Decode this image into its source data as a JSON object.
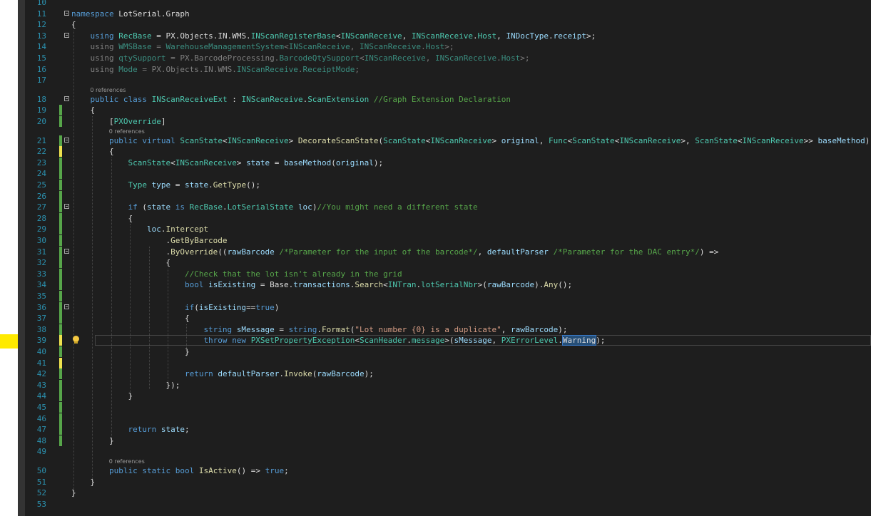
{
  "editor": {
    "lines": [
      {
        "n": "10",
        "tokens": []
      },
      {
        "n": "11",
        "tokens": [
          [
            "k",
            "namespace"
          ],
          [
            "p",
            " LotSerial.Graph"
          ]
        ]
      },
      {
        "n": "12",
        "tokens": [
          [
            "p",
            "{"
          ]
        ]
      },
      {
        "n": "13",
        "tokens": [
          [
            "p",
            "    "
          ],
          [
            "k",
            "using"
          ],
          [
            "p",
            " "
          ],
          [
            "t",
            "RecBase"
          ],
          [
            "p",
            " = PX.Objects.IN.WMS."
          ],
          [
            "t",
            "INScanRegisterBase"
          ],
          [
            "p",
            "<"
          ],
          [
            "t",
            "INScanReceive"
          ],
          [
            "p",
            ", "
          ],
          [
            "t",
            "INScanReceive"
          ],
          [
            "p",
            "."
          ],
          [
            "t",
            "Host"
          ],
          [
            "p",
            ", "
          ],
          [
            "v",
            "INDocType"
          ],
          [
            "p",
            "."
          ],
          [
            "v",
            "receipt"
          ],
          [
            "p",
            ">;"
          ]
        ]
      },
      {
        "n": "14",
        "tokens": [
          [
            "p",
            "    "
          ],
          [
            "g",
            "using "
          ],
          [
            "gt",
            "WMSBase"
          ],
          [
            "g",
            " = "
          ],
          [
            "gt",
            "WarehouseManagementSystem"
          ],
          [
            "g",
            "<"
          ],
          [
            "gt",
            "INScanReceive"
          ],
          [
            "g",
            ", "
          ],
          [
            "gt",
            "INScanReceive"
          ],
          [
            "g",
            "."
          ],
          [
            "gt",
            "Host"
          ],
          [
            "g",
            ">;"
          ]
        ]
      },
      {
        "n": "15",
        "tokens": [
          [
            "p",
            "    "
          ],
          [
            "g",
            "using "
          ],
          [
            "gt",
            "qtySupport"
          ],
          [
            "g",
            " = PX.BarcodeProcessing."
          ],
          [
            "gt",
            "BarcodeQtySupport"
          ],
          [
            "g",
            "<"
          ],
          [
            "gt",
            "INScanReceive"
          ],
          [
            "g",
            ", "
          ],
          [
            "gt",
            "INScanReceive"
          ],
          [
            "g",
            "."
          ],
          [
            "gt",
            "Host"
          ],
          [
            "g",
            ">;"
          ]
        ]
      },
      {
        "n": "16",
        "tokens": [
          [
            "p",
            "    "
          ],
          [
            "g",
            "using "
          ],
          [
            "gt",
            "Mode"
          ],
          [
            "g",
            " = PX.Objects.IN.WMS."
          ],
          [
            "gt",
            "INScanReceive"
          ],
          [
            "g",
            "."
          ],
          [
            "gt",
            "ReceiptMode"
          ],
          [
            "g",
            ";"
          ]
        ]
      },
      {
        "n": "17",
        "tokens": []
      },
      {
        "n": "18",
        "tokens": [
          [
            "p",
            "    "
          ],
          [
            "k",
            "public"
          ],
          [
            "p",
            " "
          ],
          [
            "k",
            "class"
          ],
          [
            "p",
            " "
          ],
          [
            "t",
            "INScanReceiveExt"
          ],
          [
            "p",
            " : "
          ],
          [
            "t",
            "INScanReceive"
          ],
          [
            "p",
            "."
          ],
          [
            "t",
            "ScanExtension"
          ],
          [
            "p",
            " "
          ],
          [
            "c",
            "//Graph Extension Declaration"
          ]
        ]
      },
      {
        "n": "19",
        "tokens": [
          [
            "p",
            "    {"
          ]
        ]
      },
      {
        "n": "20",
        "tokens": [
          [
            "p",
            "        ["
          ],
          [
            "t",
            "PXOverride"
          ],
          [
            "p",
            "]"
          ]
        ]
      },
      {
        "n": "21",
        "tokens": [
          [
            "p",
            "        "
          ],
          [
            "k",
            "public"
          ],
          [
            "p",
            " "
          ],
          [
            "k",
            "virtual"
          ],
          [
            "p",
            " "
          ],
          [
            "t",
            "ScanState"
          ],
          [
            "p",
            "<"
          ],
          [
            "t",
            "INScanReceive"
          ],
          [
            "p",
            "> "
          ],
          [
            "m",
            "DecorateScanState"
          ],
          [
            "p",
            "("
          ],
          [
            "t",
            "ScanState"
          ],
          [
            "p",
            "<"
          ],
          [
            "t",
            "INScanReceive"
          ],
          [
            "p",
            "> "
          ],
          [
            "v",
            "original"
          ],
          [
            "p",
            ", "
          ],
          [
            "t",
            "Func"
          ],
          [
            "p",
            "<"
          ],
          [
            "t",
            "ScanState"
          ],
          [
            "p",
            "<"
          ],
          [
            "t",
            "INScanReceive"
          ],
          [
            "p",
            ">, "
          ],
          [
            "t",
            "ScanState"
          ],
          [
            "p",
            "<"
          ],
          [
            "t",
            "INScanReceive"
          ],
          [
            "p",
            ">> "
          ],
          [
            "v",
            "baseMethod"
          ],
          [
            "p",
            ")"
          ]
        ]
      },
      {
        "n": "22",
        "tokens": [
          [
            "p",
            "        {"
          ]
        ]
      },
      {
        "n": "23",
        "tokens": [
          [
            "p",
            "            "
          ],
          [
            "t",
            "ScanState"
          ],
          [
            "p",
            "<"
          ],
          [
            "t",
            "INScanReceive"
          ],
          [
            "p",
            "> "
          ],
          [
            "v",
            "state"
          ],
          [
            "p",
            " = "
          ],
          [
            "v",
            "baseMethod"
          ],
          [
            "p",
            "("
          ],
          [
            "v",
            "original"
          ],
          [
            "p",
            ");"
          ]
        ]
      },
      {
        "n": "24",
        "tokens": []
      },
      {
        "n": "25",
        "tokens": [
          [
            "p",
            "            "
          ],
          [
            "t",
            "Type"
          ],
          [
            "p",
            " "
          ],
          [
            "v",
            "type"
          ],
          [
            "p",
            " = "
          ],
          [
            "v",
            "state"
          ],
          [
            "p",
            "."
          ],
          [
            "m",
            "GetType"
          ],
          [
            "p",
            "();"
          ]
        ]
      },
      {
        "n": "26",
        "tokens": []
      },
      {
        "n": "27",
        "tokens": [
          [
            "p",
            "            "
          ],
          [
            "k",
            "if"
          ],
          [
            "p",
            " ("
          ],
          [
            "v",
            "state"
          ],
          [
            "p",
            " "
          ],
          [
            "k",
            "is"
          ],
          [
            "p",
            " "
          ],
          [
            "t",
            "RecBase"
          ],
          [
            "p",
            "."
          ],
          [
            "t",
            "LotSerialState"
          ],
          [
            "p",
            " "
          ],
          [
            "v",
            "loc"
          ],
          [
            "p",
            ")"
          ],
          [
            "c",
            "//You might need a different state"
          ]
        ]
      },
      {
        "n": "28",
        "tokens": [
          [
            "p",
            "            {"
          ]
        ]
      },
      {
        "n": "29",
        "tokens": [
          [
            "p",
            "                "
          ],
          [
            "v",
            "loc"
          ],
          [
            "p",
            "."
          ],
          [
            "m",
            "Intercept"
          ]
        ]
      },
      {
        "n": "30",
        "tokens": [
          [
            "p",
            "                    ."
          ],
          [
            "m",
            "GetByBarcode"
          ]
        ]
      },
      {
        "n": "31",
        "tokens": [
          [
            "p",
            "                    ."
          ],
          [
            "m",
            "ByOverride"
          ],
          [
            "p",
            "(("
          ],
          [
            "v",
            "rawBarcode"
          ],
          [
            "p",
            " "
          ],
          [
            "c",
            "/*Parameter for the input of the barcode*/"
          ],
          [
            "p",
            ", "
          ],
          [
            "v",
            "defaultParser"
          ],
          [
            "p",
            " "
          ],
          [
            "c",
            "/*Parameter for the DAC entry*/"
          ],
          [
            "p",
            ") =>"
          ]
        ]
      },
      {
        "n": "32",
        "tokens": [
          [
            "p",
            "                    {"
          ]
        ]
      },
      {
        "n": "33",
        "tokens": [
          [
            "p",
            "                        "
          ],
          [
            "c",
            "//Check that the lot isn't already in the grid"
          ]
        ]
      },
      {
        "n": "34",
        "tokens": [
          [
            "p",
            "                        "
          ],
          [
            "k",
            "bool"
          ],
          [
            "p",
            " "
          ],
          [
            "v",
            "isExisting"
          ],
          [
            "p",
            " = Base."
          ],
          [
            "v",
            "transactions"
          ],
          [
            "p",
            "."
          ],
          [
            "m",
            "Search"
          ],
          [
            "p",
            "<"
          ],
          [
            "t",
            "INTran"
          ],
          [
            "p",
            "."
          ],
          [
            "t",
            "lotSerialNbr"
          ],
          [
            "p",
            ">("
          ],
          [
            "v",
            "rawBarcode"
          ],
          [
            "p",
            ")."
          ],
          [
            "m",
            "Any"
          ],
          [
            "p",
            "();"
          ]
        ]
      },
      {
        "n": "35",
        "tokens": []
      },
      {
        "n": "36",
        "tokens": [
          [
            "p",
            "                        "
          ],
          [
            "k",
            "if"
          ],
          [
            "p",
            "("
          ],
          [
            "v",
            "isExisting"
          ],
          [
            "p",
            "=="
          ],
          [
            "k",
            "true"
          ],
          [
            "p",
            ")"
          ]
        ]
      },
      {
        "n": "37",
        "tokens": [
          [
            "p",
            "                        {"
          ]
        ]
      },
      {
        "n": "38",
        "tokens": [
          [
            "p",
            "                            "
          ],
          [
            "k",
            "string"
          ],
          [
            "p",
            " "
          ],
          [
            "v",
            "sMessage"
          ],
          [
            "p",
            " = "
          ],
          [
            "k",
            "string"
          ],
          [
            "p",
            "."
          ],
          [
            "m",
            "Format"
          ],
          [
            "p",
            "("
          ],
          [
            "s",
            "\"Lot number {0} is a duplicate\""
          ],
          [
            "p",
            ", "
          ],
          [
            "v",
            "rawBarcode"
          ],
          [
            "p",
            ");"
          ]
        ]
      },
      {
        "n": "39",
        "tokens": [
          [
            "p",
            "                            "
          ],
          [
            "k",
            "throw"
          ],
          [
            "p",
            " "
          ],
          [
            "k",
            "new"
          ],
          [
            "p",
            " "
          ],
          [
            "t",
            "PXSetPropertyException"
          ],
          [
            "p",
            "<"
          ],
          [
            "t",
            "ScanHeader"
          ],
          [
            "p",
            "."
          ],
          [
            "t",
            "message"
          ],
          [
            "p",
            ">("
          ],
          [
            "v",
            "sMessage"
          ],
          [
            "p",
            ", "
          ],
          [
            "t",
            "PXErrorLevel"
          ],
          [
            "p",
            "."
          ],
          [
            "sel",
            "Warning"
          ],
          [
            "p",
            ");"
          ]
        ]
      },
      {
        "n": "40",
        "tokens": [
          [
            "p",
            "                        }"
          ]
        ]
      },
      {
        "n": "41",
        "tokens": []
      },
      {
        "n": "42",
        "tokens": [
          [
            "p",
            "                        "
          ],
          [
            "k",
            "return"
          ],
          [
            "p",
            " "
          ],
          [
            "v",
            "defaultParser"
          ],
          [
            "p",
            "."
          ],
          [
            "m",
            "Invoke"
          ],
          [
            "p",
            "("
          ],
          [
            "v",
            "rawBarcode"
          ],
          [
            "p",
            ");"
          ]
        ]
      },
      {
        "n": "43",
        "tokens": [
          [
            "p",
            "                    });"
          ]
        ]
      },
      {
        "n": "44",
        "tokens": [
          [
            "p",
            "            }"
          ]
        ]
      },
      {
        "n": "45",
        "tokens": []
      },
      {
        "n": "46",
        "tokens": []
      },
      {
        "n": "47",
        "tokens": [
          [
            "p",
            "            "
          ],
          [
            "k",
            "return"
          ],
          [
            "p",
            " "
          ],
          [
            "v",
            "state"
          ],
          [
            "p",
            ";"
          ]
        ]
      },
      {
        "n": "48",
        "tokens": [
          [
            "p",
            "        }"
          ]
        ]
      },
      {
        "n": "49",
        "tokens": []
      },
      {
        "n": "50",
        "tokens": [
          [
            "p",
            "        "
          ],
          [
            "k",
            "public"
          ],
          [
            "p",
            " "
          ],
          [
            "k",
            "static"
          ],
          [
            "p",
            " "
          ],
          [
            "k",
            "bool"
          ],
          [
            "p",
            " "
          ],
          [
            "m",
            "IsActive"
          ],
          [
            "p",
            "() => "
          ],
          [
            "k",
            "true"
          ],
          [
            "p",
            ";"
          ]
        ]
      },
      {
        "n": "51",
        "tokens": [
          [
            "p",
            "    }"
          ]
        ]
      },
      {
        "n": "52",
        "tokens": [
          [
            "p",
            "}"
          ]
        ]
      },
      {
        "n": "53",
        "tokens": []
      }
    ],
    "references": [
      {
        "after_line": "17",
        "text": "0 references",
        "indent": 4
      },
      {
        "after_line": "20",
        "text": "0 references",
        "indent": 8
      },
      {
        "after_line": "49",
        "text": "0 references",
        "indent": 8
      }
    ],
    "fold_lines": [
      "11",
      "13",
      "18",
      "21",
      "27",
      "31",
      "36"
    ],
    "saved_change_lines": [
      "19",
      "20",
      "21",
      "23",
      "24",
      "25",
      "26",
      "27",
      "28",
      "29",
      "30",
      "31",
      "32",
      "33",
      "34",
      "35",
      "36",
      "37",
      "38",
      "40",
      "42",
      "43",
      "44",
      "45",
      "46",
      "47",
      "48"
    ],
    "unsaved_change_lines": [
      "22",
      "39",
      "41"
    ],
    "current_line": "39",
    "lightbulb_line": "39"
  },
  "colors": {
    "background": "#1e1e1e",
    "line_number": "#2b91af",
    "keyword": "#569cd6",
    "type": "#4ec9b0",
    "method": "#dcdcaa",
    "variable": "#9cdcfe",
    "comment": "#57a64a",
    "string": "#d69d85",
    "plain": "#dcdcdc",
    "change_saved": "#57a64a",
    "change_unsaved": "#efe34f",
    "selection": "#264f78",
    "side_marker": "#ffea00"
  },
  "icons": {
    "lightbulb": "lightbulb-icon",
    "fold": "collapse-icon"
  }
}
